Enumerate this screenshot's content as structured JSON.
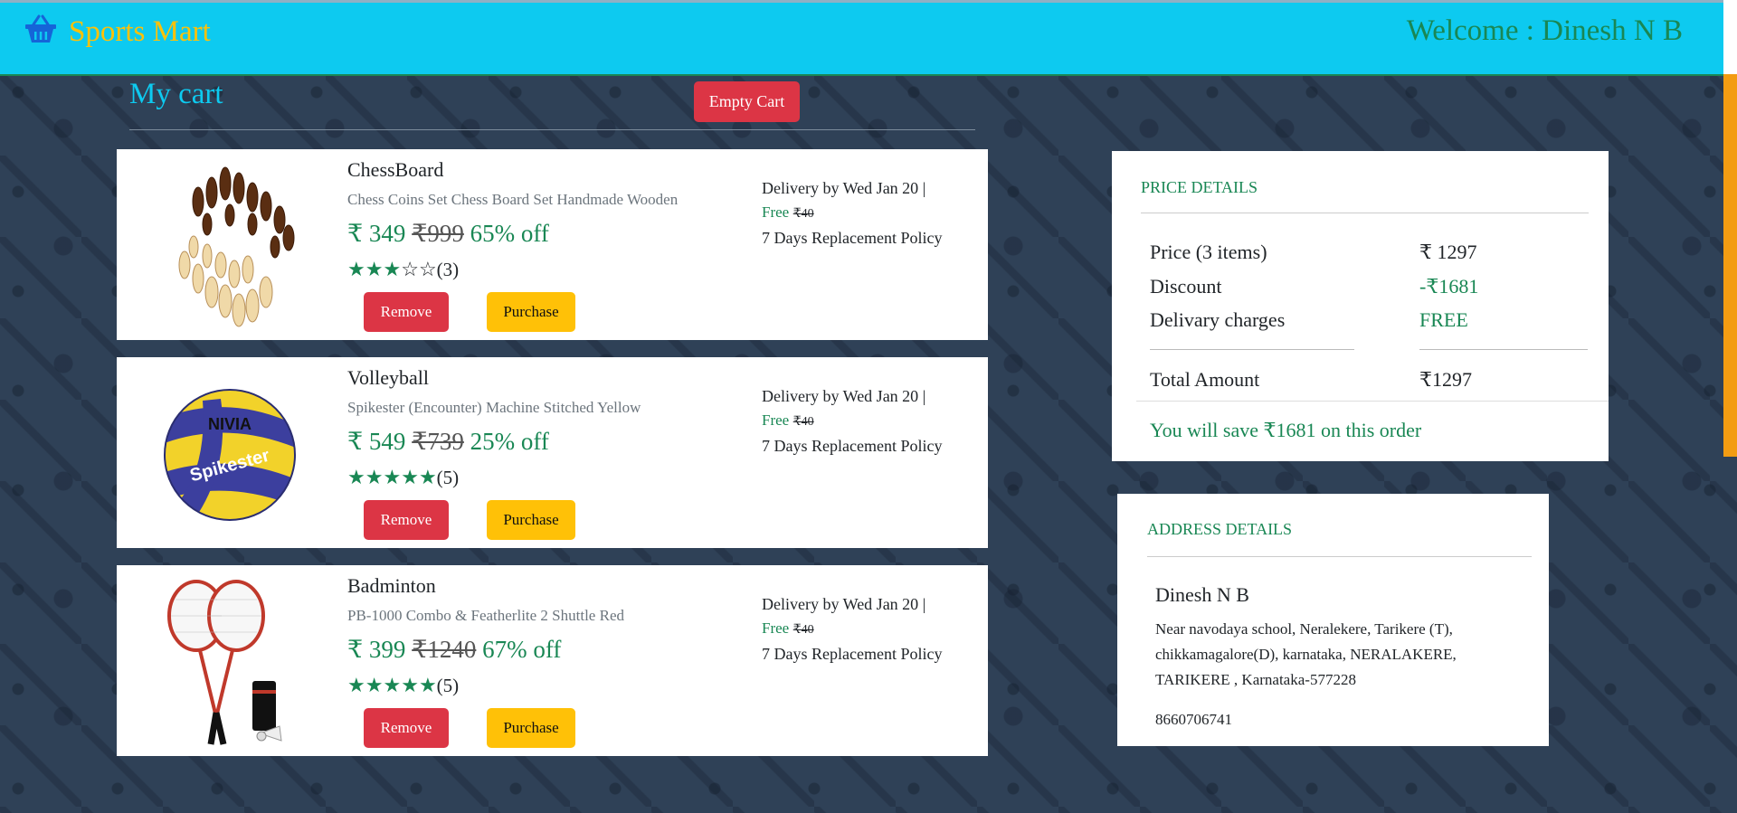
{
  "header": {
    "brand": "Sports Mart",
    "welcome": "Welcome : Dinesh N B",
    "brand_icon": "basket-icon",
    "colors": {
      "navbar": "#0dcaf0",
      "brand": "#ffc107",
      "accent_green": "#198754"
    }
  },
  "cart": {
    "title": "My cart",
    "empty_button": "Empty Cart",
    "items": [
      {
        "name": "ChessBoard",
        "description": "Chess Coins Set Chess Board Set Handmade Wooden",
        "price": "₹ 349",
        "mrp": "₹999",
        "discount": "65% off",
        "rating": 3,
        "rating_count": "(3)",
        "remove_label": "Remove",
        "purchase_label": "Purchase",
        "delivery": "Delivery by Wed Jan 20 |",
        "free": "Free",
        "shipping_old": "₹40",
        "replacement": "7 Days Replacement Policy"
      },
      {
        "name": "Volleyball",
        "description": "Spikester (Encounter) Machine Stitched Yellow",
        "price": "₹ 549",
        "mrp": "₹739",
        "discount": "25% off",
        "rating": 5,
        "rating_count": "(5)",
        "remove_label": "Remove",
        "purchase_label": "Purchase",
        "delivery": "Delivery by Wed Jan 20 |",
        "free": "Free",
        "shipping_old": "₹40",
        "replacement": "7 Days Replacement Policy",
        "ball_text_brand": "NIVIA",
        "ball_text_model": "Spikester"
      },
      {
        "name": "Badminton",
        "description": "PB-1000 Combo & Featherlite 2 Shuttle Red",
        "price": "₹ 399",
        "mrp": "₹1240",
        "discount": "67% off",
        "rating": 5,
        "rating_count": "(5)",
        "remove_label": "Remove",
        "purchase_label": "Purchase",
        "delivery": "Delivery by Wed Jan 20 |",
        "free": "Free",
        "shipping_old": "₹40",
        "replacement": "7 Days Replacement Policy"
      }
    ]
  },
  "price_details": {
    "heading": "PRICE DETAILS",
    "price_label": "Price (3 items)",
    "price_value": "₹ 1297",
    "discount_label": "Discount",
    "discount_value": "-₹1681",
    "delivery_label": "Delivary charges",
    "delivery_value": "FREE",
    "total_label": "Total Amount",
    "total_value": "₹1297",
    "savings": "You will save ₹1681 on this order"
  },
  "address": {
    "heading": "ADDRESS DETAILS",
    "name": "Dinesh N B",
    "lines": "Near navodaya school, Neralekere, Tarikere (T), chikkamagalore(D), karnataka, NERALAKERE, TARIKERE , Karnataka-577228",
    "phone": "8660706741"
  }
}
